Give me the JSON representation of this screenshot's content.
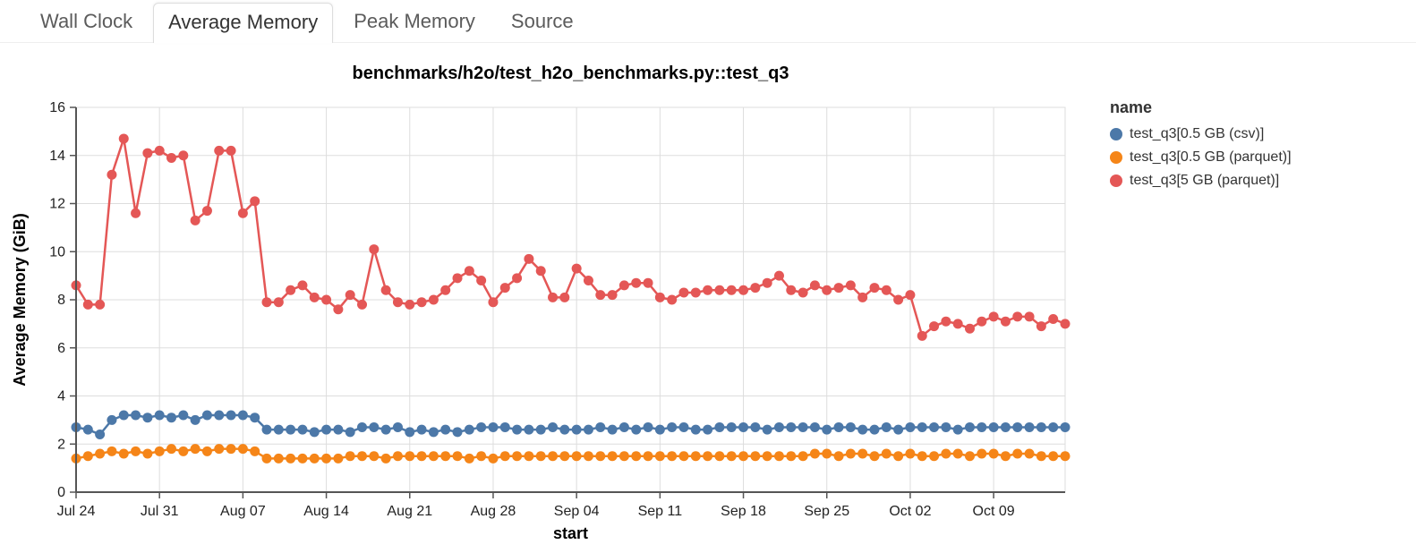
{
  "tabs": [
    {
      "label": "Wall Clock",
      "active": false
    },
    {
      "label": "Average Memory",
      "active": true
    },
    {
      "label": "Peak Memory",
      "active": false
    },
    {
      "label": "Source",
      "active": false
    }
  ],
  "legend_title": "name",
  "colors": {
    "csv05": "#4c78a8",
    "parq05": "#f58518",
    "parq5": "#e45756"
  },
  "chart_data": {
    "type": "line",
    "title": "benchmarks/h2o/test_h2o_benchmarks.py::test_q3",
    "xlabel": "start",
    "ylabel": "Average Memory (GiB)",
    "ylim": [
      0,
      16
    ],
    "yticks": [
      0,
      2,
      4,
      6,
      8,
      10,
      12,
      14,
      16
    ],
    "x_tick_labels": [
      "Jul 24",
      "Jul 31",
      "Aug 07",
      "Aug 14",
      "Aug 21",
      "Aug 28",
      "Sep 04",
      "Sep 11",
      "Sep 18",
      "Sep 25",
      "Oct 02",
      "Oct 09"
    ],
    "x_tick_indices": [
      0,
      7,
      14,
      21,
      28,
      35,
      42,
      49,
      56,
      63,
      70,
      77
    ],
    "x_index_range": [
      0,
      83
    ],
    "categories_start": "Jul 24",
    "categories_step": "days",
    "series": [
      {
        "name": "test_q3[0.5 GB (csv)]",
        "color_key": "csv05",
        "values": [
          2.7,
          2.6,
          2.4,
          3.0,
          3.2,
          3.2,
          3.1,
          3.2,
          3.1,
          3.2,
          3.0,
          3.2,
          3.2,
          3.2,
          3.2,
          3.1,
          2.6,
          2.6,
          2.6,
          2.6,
          2.5,
          2.6,
          2.6,
          2.5,
          2.7,
          2.7,
          2.6,
          2.7,
          2.5,
          2.6,
          2.5,
          2.6,
          2.5,
          2.6,
          2.7,
          2.7,
          2.7,
          2.6,
          2.6,
          2.6,
          2.7,
          2.6,
          2.6,
          2.6,
          2.7,
          2.6,
          2.7,
          2.6,
          2.7,
          2.6,
          2.7,
          2.7,
          2.6,
          2.6,
          2.7,
          2.7,
          2.7,
          2.7,
          2.6,
          2.7,
          2.7,
          2.7,
          2.7,
          2.6,
          2.7,
          2.7,
          2.6,
          2.6,
          2.7,
          2.6,
          2.7,
          2.7,
          2.7,
          2.7,
          2.6,
          2.7,
          2.7,
          2.7,
          2.7,
          2.7,
          2.7,
          2.7,
          2.7,
          2.7
        ]
      },
      {
        "name": "test_q3[0.5 GB (parquet)]",
        "color_key": "parq05",
        "values": [
          1.4,
          1.5,
          1.6,
          1.7,
          1.6,
          1.7,
          1.6,
          1.7,
          1.8,
          1.7,
          1.8,
          1.7,
          1.8,
          1.8,
          1.8,
          1.7,
          1.4,
          1.4,
          1.4,
          1.4,
          1.4,
          1.4,
          1.4,
          1.5,
          1.5,
          1.5,
          1.4,
          1.5,
          1.5,
          1.5,
          1.5,
          1.5,
          1.5,
          1.4,
          1.5,
          1.4,
          1.5,
          1.5,
          1.5,
          1.5,
          1.5,
          1.5,
          1.5,
          1.5,
          1.5,
          1.5,
          1.5,
          1.5,
          1.5,
          1.5,
          1.5,
          1.5,
          1.5,
          1.5,
          1.5,
          1.5,
          1.5,
          1.5,
          1.5,
          1.5,
          1.5,
          1.5,
          1.6,
          1.6,
          1.5,
          1.6,
          1.6,
          1.5,
          1.6,
          1.5,
          1.6,
          1.5,
          1.5,
          1.6,
          1.6,
          1.5,
          1.6,
          1.6,
          1.5,
          1.6,
          1.6,
          1.5,
          1.5,
          1.5
        ]
      },
      {
        "name": "test_q3[5 GB (parquet)]",
        "color_key": "parq5",
        "values": [
          8.6,
          7.8,
          7.8,
          13.2,
          14.7,
          11.6,
          14.1,
          14.2,
          13.9,
          14.0,
          11.3,
          11.7,
          14.2,
          14.2,
          11.6,
          12.1,
          7.9,
          7.9,
          8.4,
          8.6,
          8.1,
          8.0,
          7.6,
          8.2,
          7.8,
          10.1,
          8.4,
          7.9,
          7.8,
          7.9,
          8.0,
          8.4,
          8.9,
          9.2,
          8.8,
          7.9,
          8.5,
          8.9,
          9.7,
          9.2,
          8.1,
          8.1,
          9.3,
          8.8,
          8.2,
          8.2,
          8.6,
          8.7,
          8.7,
          8.1,
          8.0,
          8.3,
          8.3,
          8.4,
          8.4,
          8.4,
          8.4,
          8.5,
          8.7,
          9.0,
          8.4,
          8.3,
          8.6,
          8.4,
          8.5,
          8.6,
          8.1,
          8.5,
          8.4,
          8.0,
          8.2,
          6.5,
          6.9,
          7.1,
          7.0,
          6.8,
          7.1,
          7.3,
          7.1,
          7.3,
          7.3,
          6.9,
          7.2,
          7.0
        ]
      }
    ]
  }
}
